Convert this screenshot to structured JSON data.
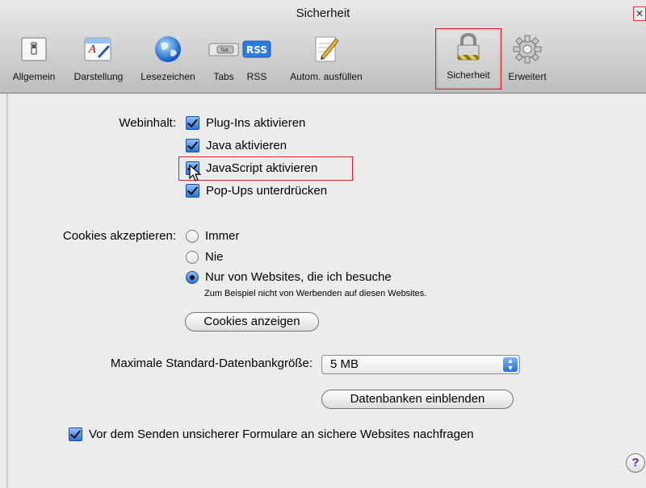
{
  "window": {
    "title": "Sicherheit",
    "close_glyph": "✕"
  },
  "toolbar": {
    "items": [
      {
        "label": "Allgemein",
        "icon": "switch-icon"
      },
      {
        "label": "Darstellung",
        "icon": "font-icon"
      },
      {
        "label": "Lesezeichen",
        "icon": "globe-icon"
      },
      {
        "label": "Tabs",
        "icon": "tab-icon",
        "icon_text": "Tab"
      },
      {
        "label": "RSS",
        "icon": "rss-icon",
        "icon_text": "RSS"
      },
      {
        "label": "Autom. ausfüllen",
        "icon": "pencil-icon"
      },
      {
        "label": "Sicherheit",
        "icon": "lock-icon",
        "selected": true
      },
      {
        "label": "Erweitert",
        "icon": "gear-icon"
      }
    ]
  },
  "webinhalt": {
    "label": "Webinhalt:",
    "options": [
      {
        "label": "Plug-Ins aktivieren",
        "checked": true
      },
      {
        "label": "Java aktivieren",
        "checked": true
      },
      {
        "label": "JavaScript aktivieren",
        "checked": true,
        "highlighted": true
      },
      {
        "label": "Pop-Ups unterdrücken",
        "checked": true
      }
    ]
  },
  "cookies": {
    "label": "Cookies akzeptieren:",
    "options": [
      {
        "label": "Immer",
        "selected": false
      },
      {
        "label": "Nie",
        "selected": false
      },
      {
        "label": "Nur von Websites, die ich besuche",
        "selected": true
      }
    ],
    "hint": "Zum Beispiel nicht von Werbenden auf diesen Websites.",
    "show_button": "Cookies anzeigen"
  },
  "database": {
    "label": "Maximale Standard-Datenbankgröße:",
    "selected_value": "5 MB",
    "show_button": "Datenbanken einblenden"
  },
  "forms": {
    "label": "Vor dem Senden unsicherer Formulare an sichere Websites nachfragen",
    "checked": true
  },
  "help": {
    "glyph": "?"
  },
  "colors": {
    "highlight": "#e21c22",
    "accent": "#2b75d8"
  }
}
